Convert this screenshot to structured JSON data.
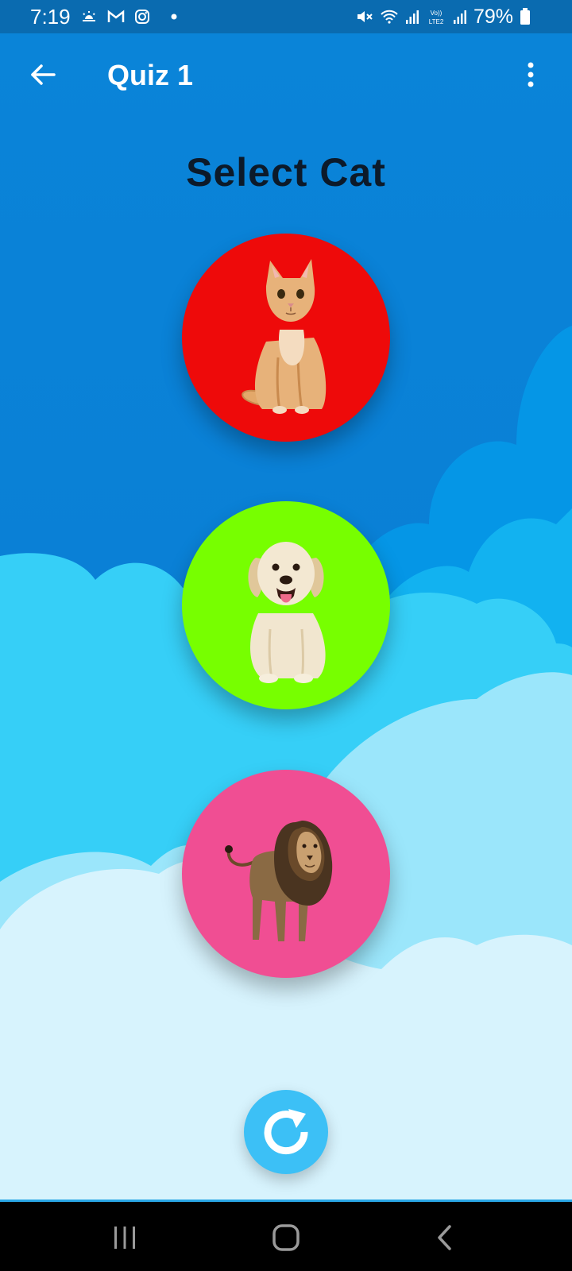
{
  "status_bar": {
    "time": "7:19",
    "battery": "79%",
    "left_icons": [
      "weather-icon",
      "gmail-icon",
      "instagram-icon",
      "dot-icon"
    ],
    "right_icons": [
      "mute-icon",
      "wifi-icon",
      "signal-icon",
      "volte-lte2-icon",
      "signal-icon",
      "battery-icon"
    ]
  },
  "app_bar": {
    "title": "Quiz 1",
    "back_icon": "arrow-left-icon",
    "menu_icon": "more-vertical-icon"
  },
  "quiz": {
    "question": "Select Cat",
    "options": [
      {
        "animal": "cat",
        "color": "#ee0a0a"
      },
      {
        "animal": "dog",
        "color": "#77ff00"
      },
      {
        "animal": "lion",
        "color": "#f04e93"
      }
    ],
    "refresh_icon": "refresh-icon"
  },
  "colors": {
    "sky_top": "#0a84d8",
    "status_bar": "#0a6bb0",
    "refresh_button": "#3cc0f6",
    "question_text": "#0c1a2a"
  },
  "nav_bar": {
    "buttons": [
      "recents-icon",
      "home-icon",
      "back-icon"
    ]
  }
}
